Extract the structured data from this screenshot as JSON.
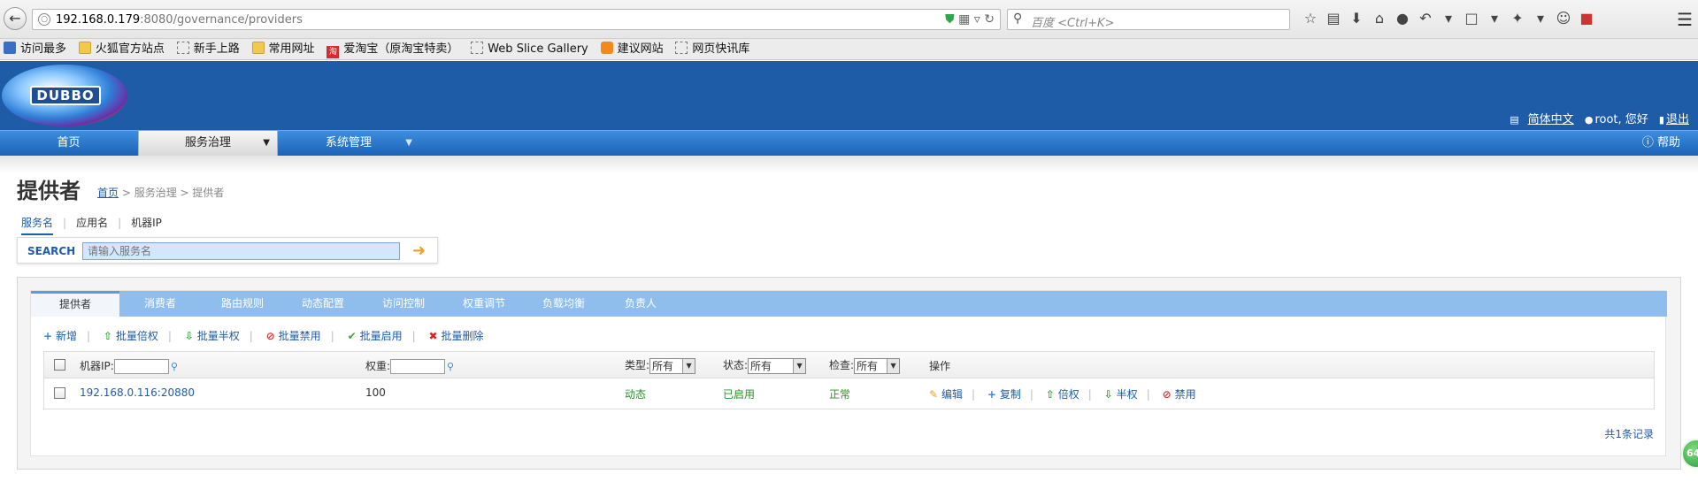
{
  "browser": {
    "url_host": "192.168.0.179",
    "url_rest": ":8080/governance/providers",
    "search_placeholder": "百度 <Ctrl+K>",
    "bookmarks": [
      "访问最多",
      "火狐官方站点",
      "新手上路",
      "常用网址",
      "爱淘宝（原淘宝特卖）",
      "Web Slice Gallery",
      "建议网站",
      "网页快讯库"
    ],
    "red_icon_glyph": "淘"
  },
  "header": {
    "logo_text": "DUBBO",
    "lang_link": "简体中文",
    "user_greeting": "root, 您好",
    "logout_link": "退出"
  },
  "nav": {
    "items": [
      "首页",
      "服务治理",
      "系统管理"
    ],
    "help": "帮助"
  },
  "page": {
    "title": "提供者",
    "breadcrumb_home": "首页",
    "breadcrumb_rest": " > 服务治理 > 提供者"
  },
  "search": {
    "tabs": [
      "服务名",
      "应用名",
      "机器IP"
    ],
    "label": "SEARCH",
    "placeholder": "请输入服务名"
  },
  "tabs": [
    "提供者",
    "消费者",
    "路由规则",
    "动态配置",
    "访问控制",
    "权重调节",
    "负载均衡",
    "负责人"
  ],
  "actions": [
    "新增",
    "批量倍权",
    "批量半权",
    "批量禁用",
    "批量启用",
    "批量删除"
  ],
  "table": {
    "head": {
      "ip_label": "机器IP:",
      "weight_label": "权重:",
      "type_label": "类型:",
      "type_value": "所有",
      "status_label": "状态:",
      "status_value": "所有",
      "check_label": "检查:",
      "check_value": "所有",
      "ops_label": "操作"
    },
    "rows": [
      {
        "address": "192.168.0.116:20880",
        "weight": "100",
        "type": "动态",
        "status": "已启用",
        "check": "正常",
        "ops": [
          "编辑",
          "复制",
          "倍权",
          "半权",
          "禁用"
        ]
      }
    ]
  },
  "total": "共1条记录",
  "floater_text": "64"
}
